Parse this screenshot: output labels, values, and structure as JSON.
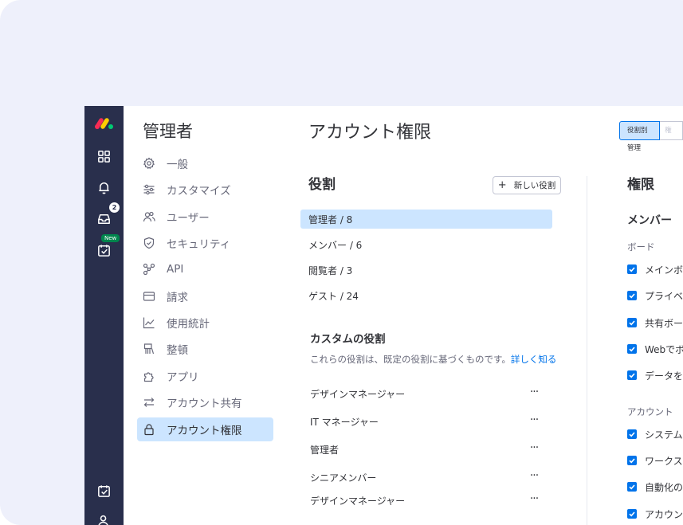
{
  "rail": {
    "inbox_badge": "2",
    "new_tag": "New"
  },
  "sidebar": {
    "title": "管理者",
    "items": [
      {
        "label": "一般",
        "icon": "gear-icon"
      },
      {
        "label": "カスタマイズ",
        "icon": "sliders-icon"
      },
      {
        "label": "ユーザー",
        "icon": "users-icon"
      },
      {
        "label": "セキュリティ",
        "icon": "shield-icon"
      },
      {
        "label": "API",
        "icon": "api-icon"
      },
      {
        "label": "請求",
        "icon": "credit-card-icon"
      },
      {
        "label": "使用統計",
        "icon": "chart-icon"
      },
      {
        "label": "整頓",
        "icon": "broom-icon"
      },
      {
        "label": "アプリ",
        "icon": "puzzle-icon"
      },
      {
        "label": "アカウント共有",
        "icon": "arrows-icon"
      },
      {
        "label": "アカウント権限",
        "icon": "lock-icon",
        "active": true
      }
    ]
  },
  "main": {
    "title": "アカウント権限",
    "view_toggle": {
      "option1": "役割別管理",
      "option2": "権"
    },
    "roles": {
      "heading": "役割",
      "new_role_button": "新しい役割",
      "items": [
        "管理者 / 8",
        "メンバー / 6",
        "閲覧者 / 3",
        "ゲスト / 24"
      ]
    },
    "custom_roles": {
      "heading": "カスタムの役割",
      "description": "これらの役割は、既定の役割に基づくものです。",
      "learn_more": "詳しく知る",
      "items": [
        "デザインマネージャー",
        "IT マネージャー",
        "管理者",
        "シニアメンバー",
        "デザインマネージャー"
      ],
      "more": "···"
    },
    "permissions": {
      "heading": "権限",
      "section": "メンバー",
      "groups": [
        {
          "name": "ボード",
          "items": [
            "メインボ",
            "プライベ",
            "共有ボー",
            "Webでボ",
            "データを"
          ]
        },
        {
          "name": "アカウント",
          "items": [
            "システム",
            "ワークス",
            "自動化の",
            "アカウン"
          ]
        }
      ]
    }
  },
  "colors": {
    "rail": "#292f4c",
    "accent": "#0073ea",
    "selected": "#cce5ff",
    "background": "#eef0fb"
  }
}
